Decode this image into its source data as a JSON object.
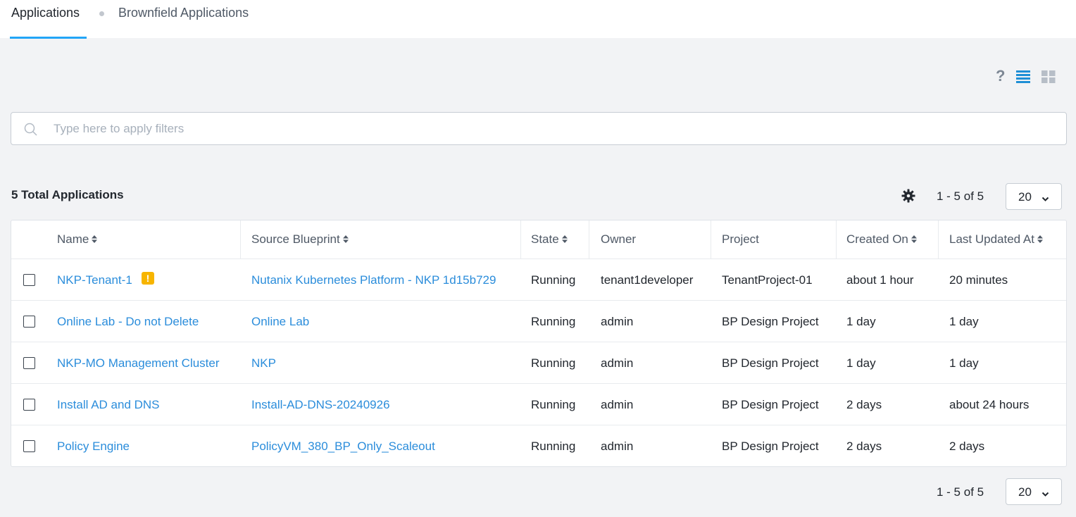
{
  "tabs": [
    {
      "label": "Applications",
      "active": true
    },
    {
      "label": "Brownfield Applications",
      "active": false
    }
  ],
  "toolbar_icons": [
    "question-icon",
    "list-view-icon",
    "grid-view-icon"
  ],
  "search": {
    "placeholder": "Type here to apply filters",
    "value": ""
  },
  "summary": {
    "total_label": "5 Total Applications"
  },
  "pagination": {
    "range_text": "1 - 5 of 5",
    "page_size": "20"
  },
  "table": {
    "headers": {
      "name": "Name",
      "source_blueprint": "Source Blueprint",
      "state": "State",
      "owner": "Owner",
      "project": "Project",
      "created_on": "Created On",
      "last_updated_at": "Last Updated At"
    },
    "rows": [
      {
        "name": "NKP-Tenant-1",
        "warning": "!",
        "source_blueprint": "Nutanix Kubernetes Platform - NKP 1d15b729",
        "state": "Running",
        "owner": "tenant1developer",
        "project": "TenantProject-01",
        "created_on": "about 1 hour",
        "last_updated_at": "20 minutes"
      },
      {
        "name": "Online Lab - Do not Delete",
        "source_blueprint": "Online Lab",
        "state": "Running",
        "owner": "admin",
        "project": "BP Design Project",
        "created_on": "1 day",
        "last_updated_at": "1 day"
      },
      {
        "name": "NKP-MO Management Cluster",
        "source_blueprint": "NKP",
        "state": "Running",
        "owner": "admin",
        "project": "BP Design Project",
        "created_on": "1 day",
        "last_updated_at": "1 day"
      },
      {
        "name": "Install AD and DNS",
        "source_blueprint": "Install-AD-DNS-20240926",
        "state": "Running",
        "owner": "admin",
        "project": "BP Design Project",
        "created_on": "2 days",
        "last_updated_at": "about 24 hours"
      },
      {
        "name": "Policy Engine",
        "source_blueprint": "PolicyVM_380_BP_Only_Scaleout",
        "state": "Running",
        "owner": "admin",
        "project": "BP Design Project",
        "created_on": "2 days",
        "last_updated_at": "2 days"
      }
    ]
  },
  "colors": {
    "accent": "#22a5f7",
    "link": "#2b8ddb",
    "warning": "#f7b500"
  }
}
